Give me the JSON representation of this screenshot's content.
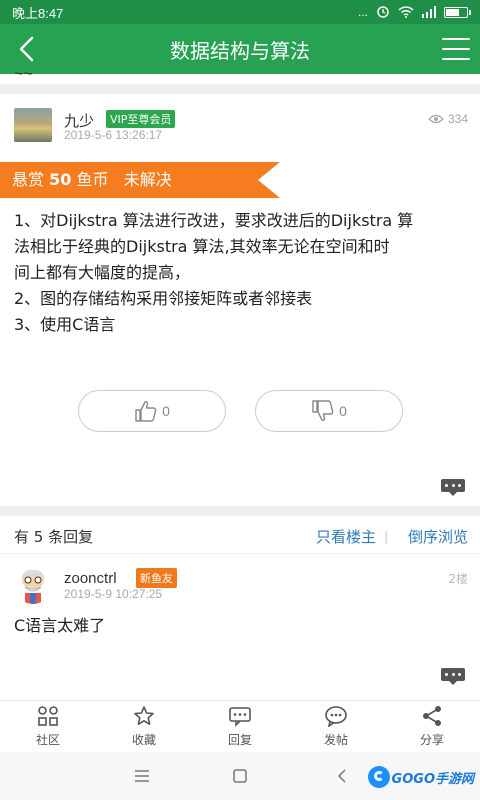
{
  "status": {
    "time": "晚上8:47",
    "signal": "..."
  },
  "header": {
    "title": "数据结构与算法"
  },
  "post": {
    "author": "九少",
    "badge": "VIP至尊会员",
    "timestamp": "2019-5-6 13:26:17",
    "views": "334",
    "bounty": {
      "prefix": "悬赏",
      "amount": "50",
      "unit": "鱼币",
      "status": "未解决"
    },
    "lines": [
      "1、对Dijkstra 算法进行改进，要求改进后的Dijkstra 算",
      "法相比于经典的Dijkstra 算法,其效率无论在空间和时",
      "间上都有大幅度的提高，",
      "2、图的存储结构采用邻接矩阵或者邻接表",
      "3、使用C语言"
    ],
    "likes": "0",
    "dislikes": "0"
  },
  "replies": {
    "count_label": "有 5 条回复",
    "only_owner": "只看楼主",
    "reverse": "倒序浏览",
    "items": [
      {
        "author": "zoonctrl",
        "badge": "新鱼友",
        "timestamp": "2019-5-9 10:27:25",
        "floor": "2楼",
        "text": "C语言太难了"
      }
    ]
  },
  "nav": {
    "items": [
      {
        "label": "社区",
        "icon": "grid-icon"
      },
      {
        "label": "收藏",
        "icon": "star-icon"
      },
      {
        "label": "回复",
        "icon": "reply-icon"
      },
      {
        "label": "发帖",
        "icon": "chat-icon"
      },
      {
        "label": "分享",
        "icon": "share-icon"
      }
    ]
  },
  "watermark": {
    "text": "GOGO手游网"
  },
  "colors": {
    "primary": "#27a152",
    "bounty": "#f57c1f",
    "link": "#2e7bb8",
    "vip": "#2ea64e",
    "new_badge": "#f07a1a"
  }
}
